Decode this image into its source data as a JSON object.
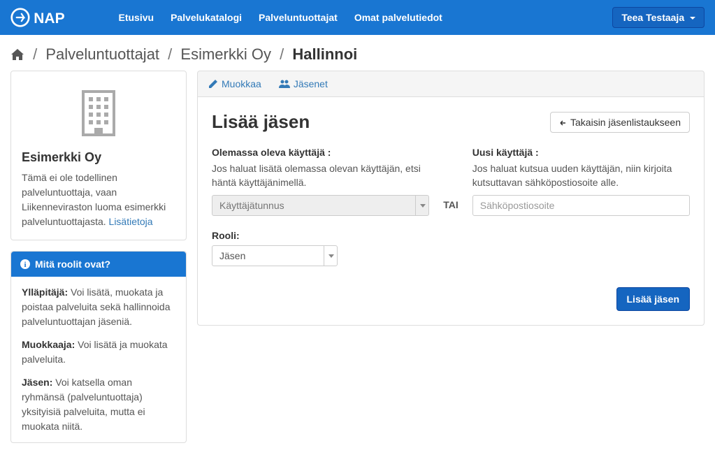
{
  "nav": {
    "brand": "NAP",
    "links": [
      "Etusivu",
      "Palvelukatalogi",
      "Palveluntuottajat",
      "Omat palvelutiedot"
    ],
    "user": "Teea Testaaja"
  },
  "breadcrumb": {
    "items": [
      "Palveluntuottajat",
      "Esimerkki Oy"
    ],
    "current": "Hallinnoi"
  },
  "sidebar": {
    "org_name": "Esimerkki Oy",
    "org_desc": "Tämä ei ole todellinen palveluntuottaja, vaan Liikenneviraston luoma esimerkki palveluntuottajasta. ",
    "more_link": "Lisätietoja",
    "roles_title": "Mitä roolit ovat?",
    "roles": [
      {
        "name": "Ylläpitäjä:",
        "desc": " Voi lisätä, muokata ja poistaa palveluita sekä hallinnoida palveluntuottajan jäseniä."
      },
      {
        "name": "Muokkaaja:",
        "desc": " Voi lisätä ja muokata palveluita."
      },
      {
        "name": "Jäsen:",
        "desc": " Voi katsella oman ryhmänsä (palveluntuottaja) yksityisiä palveluita, mutta ei muokata niitä."
      }
    ]
  },
  "tabs": {
    "edit": "Muokkaa",
    "members": "Jäsenet"
  },
  "content": {
    "title": "Lisää jäsen",
    "back_btn": "Takaisin jäsenlistaukseen",
    "existing_label": "Olemassa oleva käyttäjä :",
    "existing_help": "Jos haluat lisätä olemassa olevan käyttäjän, etsi häntä käyttäjänimellä.",
    "existing_placeholder": "Käyttäjätunnus",
    "or": "TAI",
    "new_label": "Uusi käyttäjä :",
    "new_help": "Jos haluat kutsua uuden käyttäjän, niin kirjoita kutsuttavan sähköpostiosoite alle.",
    "new_placeholder": "Sähköpostiosoite",
    "role_label": "Rooli:",
    "role_value": "Jäsen",
    "submit": "Lisää jäsen"
  }
}
